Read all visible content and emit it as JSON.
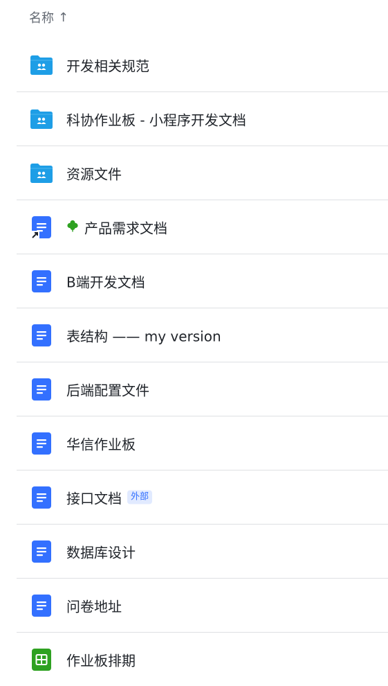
{
  "header": {
    "label": "名称",
    "sort_arrow": "↑"
  },
  "colors": {
    "folder": "#1e9ee6",
    "doc": "#3370ff",
    "sheet": "#2ea121",
    "clover": "#2ea121"
  },
  "items": [
    {
      "name": "开发相关规范",
      "icon": "shared-folder-icon"
    },
    {
      "name": "科协作业板 - 小程序开发文档",
      "icon": "shared-folder-icon"
    },
    {
      "name": "资源文件",
      "icon": "shared-folder-icon"
    },
    {
      "name": "产品需求文档",
      "icon": "doc-shortcut-icon",
      "prefix_emoji": "clover-icon"
    },
    {
      "name": "B端开发文档",
      "icon": "doc-icon"
    },
    {
      "name": "表结构 —— my version",
      "icon": "doc-icon"
    },
    {
      "name": "后端配置文件",
      "icon": "doc-icon"
    },
    {
      "name": "华信作业板",
      "icon": "doc-icon"
    },
    {
      "name": "接口文档",
      "icon": "doc-icon",
      "badge": "外部"
    },
    {
      "name": "数据库设计",
      "icon": "doc-icon"
    },
    {
      "name": "问卷地址",
      "icon": "doc-icon"
    },
    {
      "name": "作业板排期",
      "icon": "sheet-icon"
    }
  ]
}
